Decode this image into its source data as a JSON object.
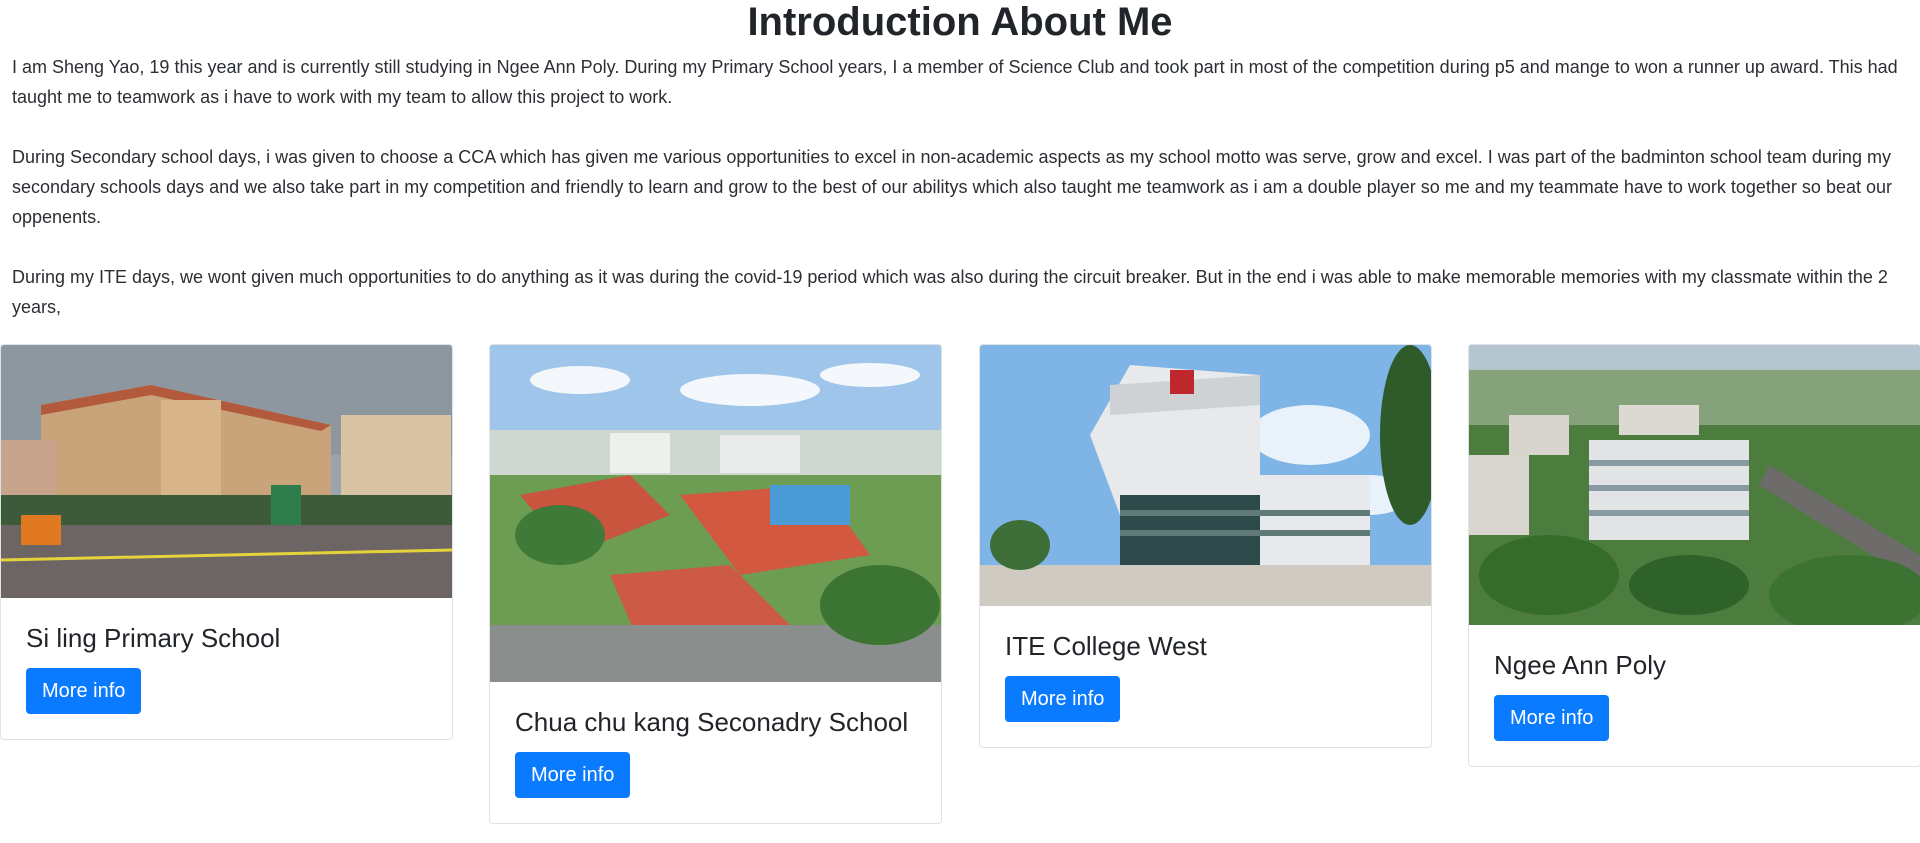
{
  "page": {
    "title": "Introduction About Me",
    "paragraphs": [
      "I am Sheng Yao, 19 this year and is currently still studying in Ngee Ann Poly. During my Primary School years, I a member of Science Club and took part in most of the competition during p5 and mange to won a runner up award. This had taught me to teamwork as i have to work with my team to allow this project to work.",
      "During Secondary school days, i was given to choose a CCA which has given me various opportunities to excel in non-academic aspects as my school motto was serve, grow and excel. I was part of the badminton school team during my secondary schools days and we also take part in my competition and friendly to learn and grow to the best of our abilitys which also taught me teamwork as i am a double player so me and my teammate have to work together so beat our oppenents.",
      "During my ITE days, we wont given much opportunities to do anything as it was during the covid-19 period which was also during the circuit breaker. But in the end i was able to make memorable memories with my classmate within the 2 years,"
    ]
  },
  "cards": [
    {
      "title": "Si ling Primary School",
      "button": "More info"
    },
    {
      "title": "Chua chu kang Seconadry School",
      "button": "More info"
    },
    {
      "title": "ITE College West",
      "button": "More info"
    },
    {
      "title": "Ngee Ann Poly",
      "button": "More info"
    }
  ],
  "colors": {
    "button": "#0a7bff",
    "text": "#212529",
    "border": "#dfe1e4"
  }
}
